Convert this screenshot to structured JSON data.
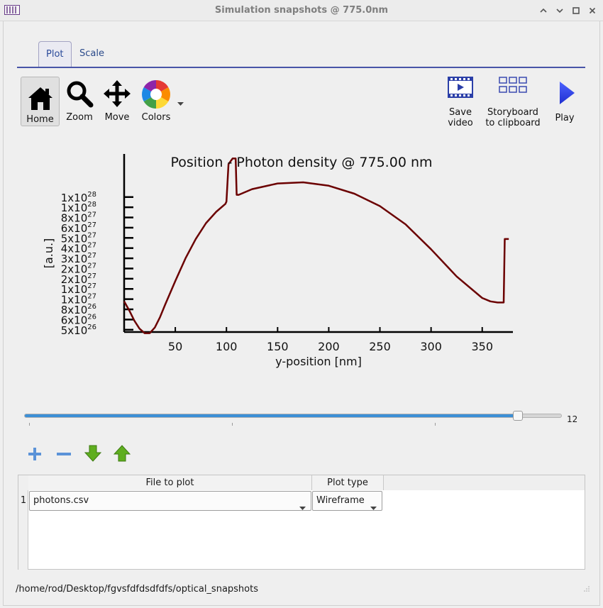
{
  "window": {
    "title": "Simulation snapshots @ 775.0nm",
    "buttons": [
      "minimize",
      "restore",
      "maximize",
      "close"
    ]
  },
  "tabs": [
    {
      "label": "Plot",
      "active": true
    },
    {
      "label": "Scale",
      "active": false
    }
  ],
  "toolbar": {
    "home": "Home",
    "zoom": "Zoom",
    "move": "Move",
    "colors": "Colors",
    "save_video_1": "Save",
    "save_video_2": "video",
    "storyboard_1": "Storyboard",
    "storyboard_2": "to clipboard",
    "play": "Play"
  },
  "chart_data": {
    "type": "line",
    "title": "Position - Photon density @ 775.00 nm",
    "xlabel": "y-position [nm]",
    "ylabel": "[a.u.]",
    "xlim": [
      0,
      380
    ],
    "ylim": [
      3e+26,
      1.6e+28
    ],
    "x_ticks": [
      50,
      100,
      150,
      200,
      250,
      300,
      350
    ],
    "y_tick_labels": [
      {
        "base": "5x10",
        "exp": "26",
        "value": 5e+26
      },
      {
        "base": "6x10",
        "exp": "26",
        "value": 1.4e+27
      },
      {
        "base": "8x10",
        "exp": "26",
        "value": 2.3e+27
      },
      {
        "base": "1x10",
        "exp": "27",
        "value": 3.2e+27
      },
      {
        "base": "1x10",
        "exp": "27",
        "value": 4.1e+27
      },
      {
        "base": "2x10",
        "exp": "27",
        "value": 5e+27
      },
      {
        "base": "2x10",
        "exp": "27",
        "value": 5.9e+27
      },
      {
        "base": "3x10",
        "exp": "27",
        "value": 6.8e+27
      },
      {
        "base": "4x10",
        "exp": "27",
        "value": 7.7e+27
      },
      {
        "base": "5x10",
        "exp": "27",
        "value": 8.6e+27
      },
      {
        "base": "6x10",
        "exp": "27",
        "value": 9.5e+27
      },
      {
        "base": "8x10",
        "exp": "27",
        "value": 1.04e+28
      },
      {
        "base": "1x10",
        "exp": "28",
        "value": 1.13e+28
      },
      {
        "base": "1x10",
        "exp": "28",
        "value": 1.22e+28
      }
    ],
    "series": [
      {
        "color": "#6b0000",
        "x": [
          0,
          5,
          10,
          15,
          20,
          25,
          30,
          35,
          40,
          50,
          60,
          70,
          80,
          90,
          99,
          100,
          102,
          106,
          109,
          110,
          112,
          125,
          150,
          175,
          200,
          225,
          250,
          275,
          300,
          325,
          350,
          358,
          365,
          371,
          372,
          376
        ],
        "y": [
          3e+27,
          2.2e+27,
          1.3e+27,
          6e+26,
          2e+26,
          2e+26,
          7e+26,
          1.6e+27,
          2.7e+27,
          4.8e+27,
          6.8e+27,
          8.5e+27,
          9.9e+27,
          1.09e+28,
          1.16e+28,
          1.18e+28,
          1.51e+28,
          1.56e+28,
          1.56e+28,
          1.24e+28,
          1.24e+28,
          1.29e+28,
          1.34e+28,
          1.35e+28,
          1.32e+28,
          1.25e+28,
          1.14e+28,
          9.8e+27,
          7.6e+27,
          5.2e+27,
          3.3e+27,
          3e+27,
          2.9e+27,
          2.9e+27,
          8.5e+27,
          8.5e+27
        ]
      }
    ]
  },
  "slider": {
    "value": "12",
    "fraction": 0.918
  },
  "table": {
    "headers": [
      "File to plot",
      "Plot type"
    ],
    "rows": [
      {
        "index": "1",
        "file": "photons.csv",
        "plot_type": "Wireframe"
      }
    ]
  },
  "status": {
    "path": "/home/rod/Desktop/fgvsfdfdsdfdfs/optical_snapshots"
  }
}
